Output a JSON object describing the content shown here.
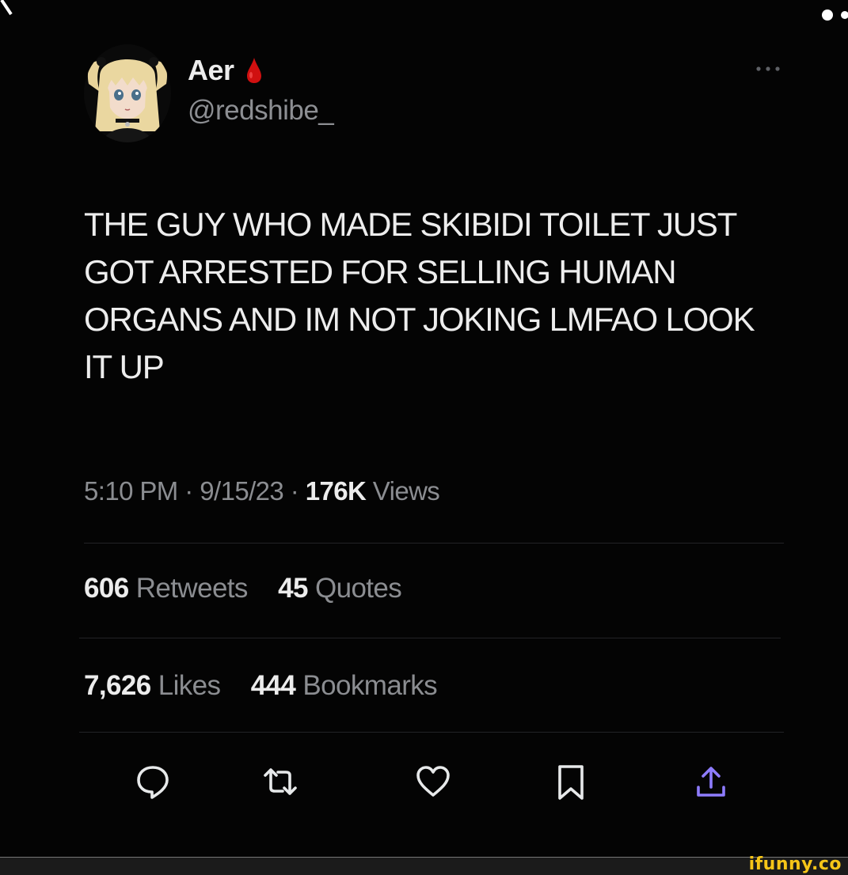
{
  "profile": {
    "display_name": "Aer",
    "name_emoji": "blood-drop-icon",
    "handle": "@redshibe_",
    "avatar": "anime-girl-avatar"
  },
  "tweet": {
    "lines": [
      "THE GUY WHO MADE SKIBIDI TOILET JUST",
      "GOT ARRESTED FOR SELLING HUMAN",
      "ORGANS AND IM NOT JOKING LMFAO LOOK",
      "IT UP"
    ]
  },
  "meta": {
    "time": "5:10 PM",
    "separator": "·",
    "date": "9/15/23",
    "views_count": "176K",
    "views_label": "Views"
  },
  "stats": {
    "retweets_count": "606",
    "retweets_label": "Retweets",
    "quotes_count": "45",
    "quotes_label": "Quotes",
    "likes_count": "7,626",
    "likes_label": "Likes",
    "bookmarks_count": "444",
    "bookmarks_label": "Bookmarks"
  },
  "actions": [
    "reply-icon",
    "retweet-icon",
    "like-icon",
    "bookmark-icon",
    "share-icon"
  ],
  "colors": {
    "background": "#040404",
    "text": "#ececec",
    "muted": "#8b8d91",
    "accent": "#8e7cff",
    "blood": "#d01010"
  },
  "watermark": "ifunny.co"
}
